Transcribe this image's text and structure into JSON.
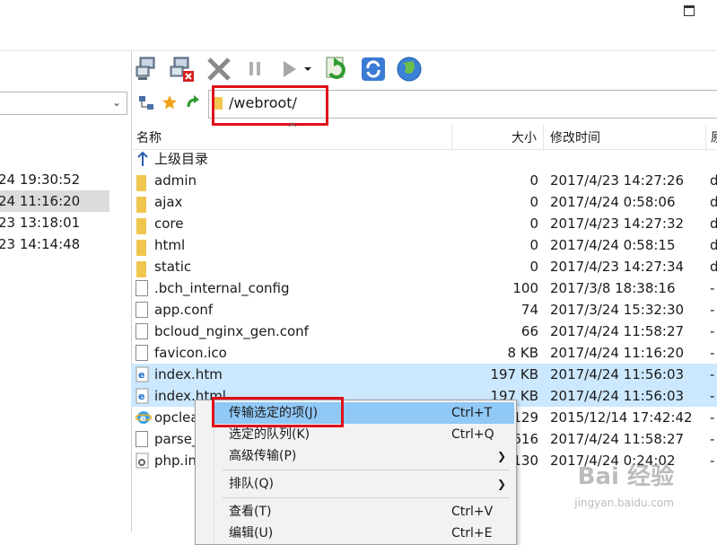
{
  "left_panel": {
    "rows": [
      "24 19:30:52",
      "24 11:16:20",
      "23 13:18:01",
      "23 14:14:48"
    ]
  },
  "toolbar": {
    "icons": [
      "network-connect-icon",
      "network-disconnect-icon",
      "cancel-icon",
      "pause-icon",
      "play-icon",
      "play-dropdown-icon",
      "sync-browse-icon",
      "refresh-icon",
      "globe-icon"
    ]
  },
  "address": {
    "path": "/webroot/"
  },
  "file_list": {
    "columns": {
      "name": "名称",
      "size": "大小",
      "modified": "修改时间",
      "extra": "原"
    },
    "rows": [
      {
        "type": "up",
        "name": "上级目录",
        "size": "",
        "modified": "",
        "extra": ""
      },
      {
        "type": "folder",
        "name": "admin",
        "size": "0",
        "modified": "2017/4/23 14:27:26",
        "extra": "d"
      },
      {
        "type": "folder",
        "name": "ajax",
        "size": "0",
        "modified": "2017/4/24 0:58:06",
        "extra": "d"
      },
      {
        "type": "folder",
        "name": "core",
        "size": "0",
        "modified": "2017/4/23 14:27:32",
        "extra": "d"
      },
      {
        "type": "folder",
        "name": "html",
        "size": "0",
        "modified": "2017/4/24 0:58:15",
        "extra": "d"
      },
      {
        "type": "folder",
        "name": "static",
        "size": "0",
        "modified": "2017/4/23 14:27:34",
        "extra": "d"
      },
      {
        "type": "file",
        "name": ".bch_internal_config",
        "size": "100",
        "modified": "2017/3/8 18:38:16",
        "extra": "-"
      },
      {
        "type": "file",
        "name": "app.conf",
        "size": "74",
        "modified": "2017/3/24 15:32:30",
        "extra": "-"
      },
      {
        "type": "file",
        "name": "bcloud_nginx_gen.conf",
        "size": "66",
        "modified": "2017/4/24 11:58:27",
        "extra": "-"
      },
      {
        "type": "file",
        "name": "favicon.ico",
        "size": "8 KB",
        "modified": "2017/4/24 11:16:20",
        "extra": "-"
      },
      {
        "type": "html",
        "name": "index.htm",
        "size": "197 KB",
        "modified": "2017/4/24 11:56:03",
        "extra": "-",
        "selected": true
      },
      {
        "type": "html",
        "name": "index.html",
        "size": "197 KB",
        "modified": "2017/4/24 11:56:03",
        "extra": "-",
        "selected": true
      },
      {
        "type": "ie",
        "name": "opclea",
        "size": "129",
        "modified": "2015/12/14 17:42:42",
        "extra": "-"
      },
      {
        "type": "file",
        "name": "parse_",
        "size": "616",
        "modified": "2017/4/24 11:58:27",
        "extra": "-"
      },
      {
        "type": "php",
        "name": "php.in",
        "size": "130",
        "modified": "2017/4/24 0:24:02",
        "extra": "-"
      }
    ]
  },
  "context_menu": {
    "items": [
      {
        "label": "传输选定的项(J)",
        "shortcut": "Ctrl+T",
        "highlighted": true
      },
      {
        "label": "选定的队列(K)",
        "shortcut": "Ctrl+Q"
      },
      {
        "label": "高级传输(P)",
        "submenu": true
      },
      {
        "label": "排队(Q)",
        "submenu": true
      },
      {
        "label": "查看(T)",
        "shortcut": "Ctrl+V"
      },
      {
        "label": "编辑(U)",
        "shortcut": "Ctrl+E"
      }
    ]
  },
  "watermark": {
    "main": "Bai 经验",
    "sub": "jingyan.baidu.com"
  },
  "colors": {
    "selection": "#cce8ff",
    "highlight_box": "#e0101a",
    "menu_highlight": "#90c8f6"
  }
}
